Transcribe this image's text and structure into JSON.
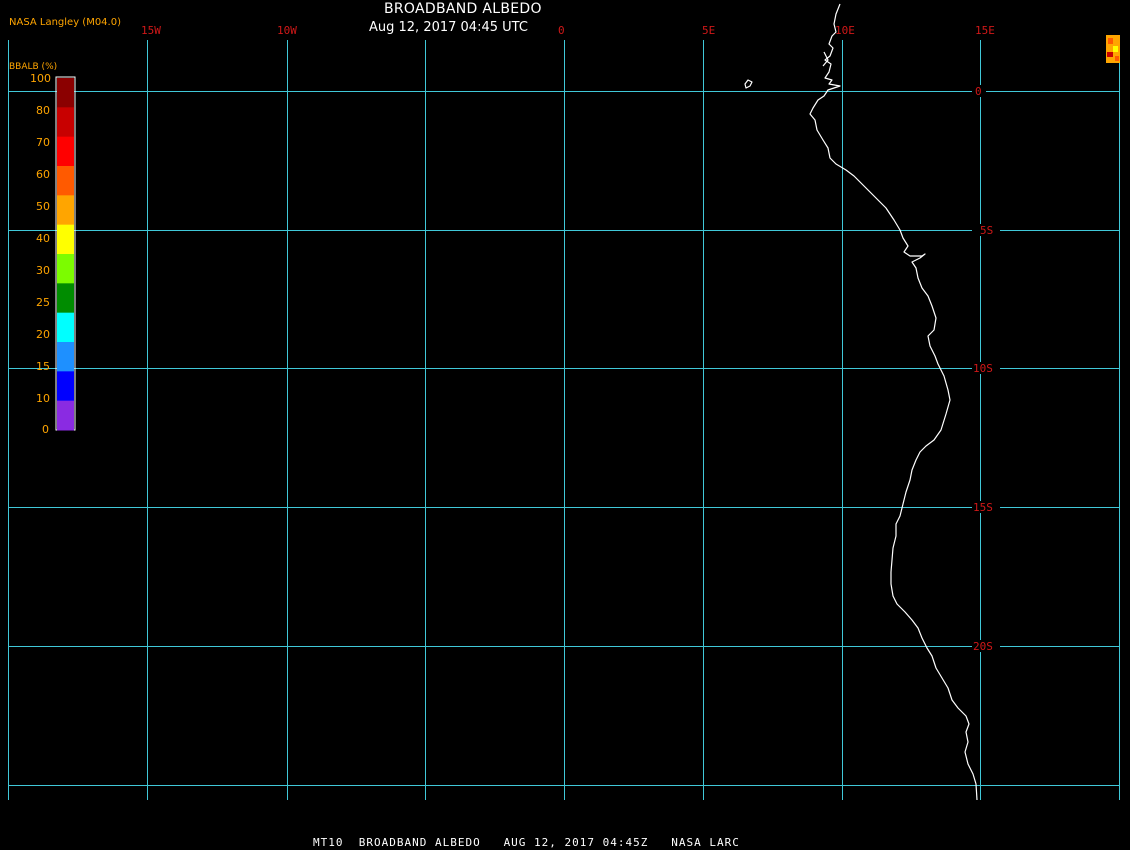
{
  "header": {
    "title": "BROADBAND ALBEDO",
    "timestamp": "Aug 12, 2017 04:45 UTC",
    "provider": "NASA Langley (M04.0)"
  },
  "legend": {
    "title": "BBALB (%)",
    "labels": [
      "100",
      "80",
      "70",
      "60",
      "50",
      "40",
      "30",
      "25",
      "20",
      "15",
      "10",
      "0"
    ],
    "colors": [
      "#8b0000",
      "#c80000",
      "#ff0000",
      "#ff5a00",
      "#ffa500",
      "#ffff00",
      "#7cfc00",
      "#008c00",
      "#00ffff",
      "#1e90ff",
      "#0000ff",
      "#8a2be2"
    ]
  },
  "grid": {
    "longitude_labels": [
      "15W",
      "10W",
      "0",
      "5E",
      "10E",
      "15E"
    ],
    "latitude_labels": [
      "0",
      "5S",
      "10S",
      "15S",
      "20S"
    ],
    "line_color": "#40c8d8",
    "label_color": "#d01818"
  },
  "map": {
    "coastline_color": "#ffffff",
    "background_color": "#000000"
  },
  "footer": {
    "text": "MT10  BROADBAND ALBEDO   AUG 12, 2017 04:45Z   NASA LARC"
  }
}
